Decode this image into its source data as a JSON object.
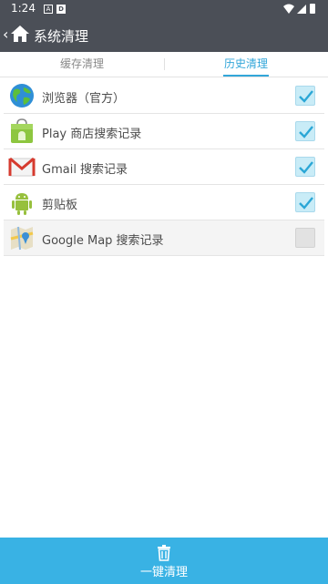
{
  "status_bar": {
    "time": "1:24",
    "notif_a": "A",
    "notif_d": "D"
  },
  "app_bar": {
    "title": "系统清理"
  },
  "tabs": [
    {
      "label": "缓存清理",
      "active": false
    },
    {
      "label": "历史清理",
      "active": true
    }
  ],
  "items": [
    {
      "label": "浏览器（官方）",
      "icon": "browser-globe-icon",
      "checked": true
    },
    {
      "label": "Play 商店搜索记录",
      "icon": "play-store-icon",
      "checked": true
    },
    {
      "label": "Gmail 搜索记录",
      "icon": "gmail-icon",
      "checked": true
    },
    {
      "label": "剪贴板",
      "icon": "android-clipboard-icon",
      "checked": true
    },
    {
      "label": "Google Map 搜索记录",
      "icon": "google-maps-icon",
      "checked": false
    }
  ],
  "bottom_action": {
    "label": "一键清理",
    "icon": "trash-icon"
  },
  "colors": {
    "accent": "#32a6d9",
    "bar": "#4b4f57",
    "bottom": "#39b2e4"
  }
}
